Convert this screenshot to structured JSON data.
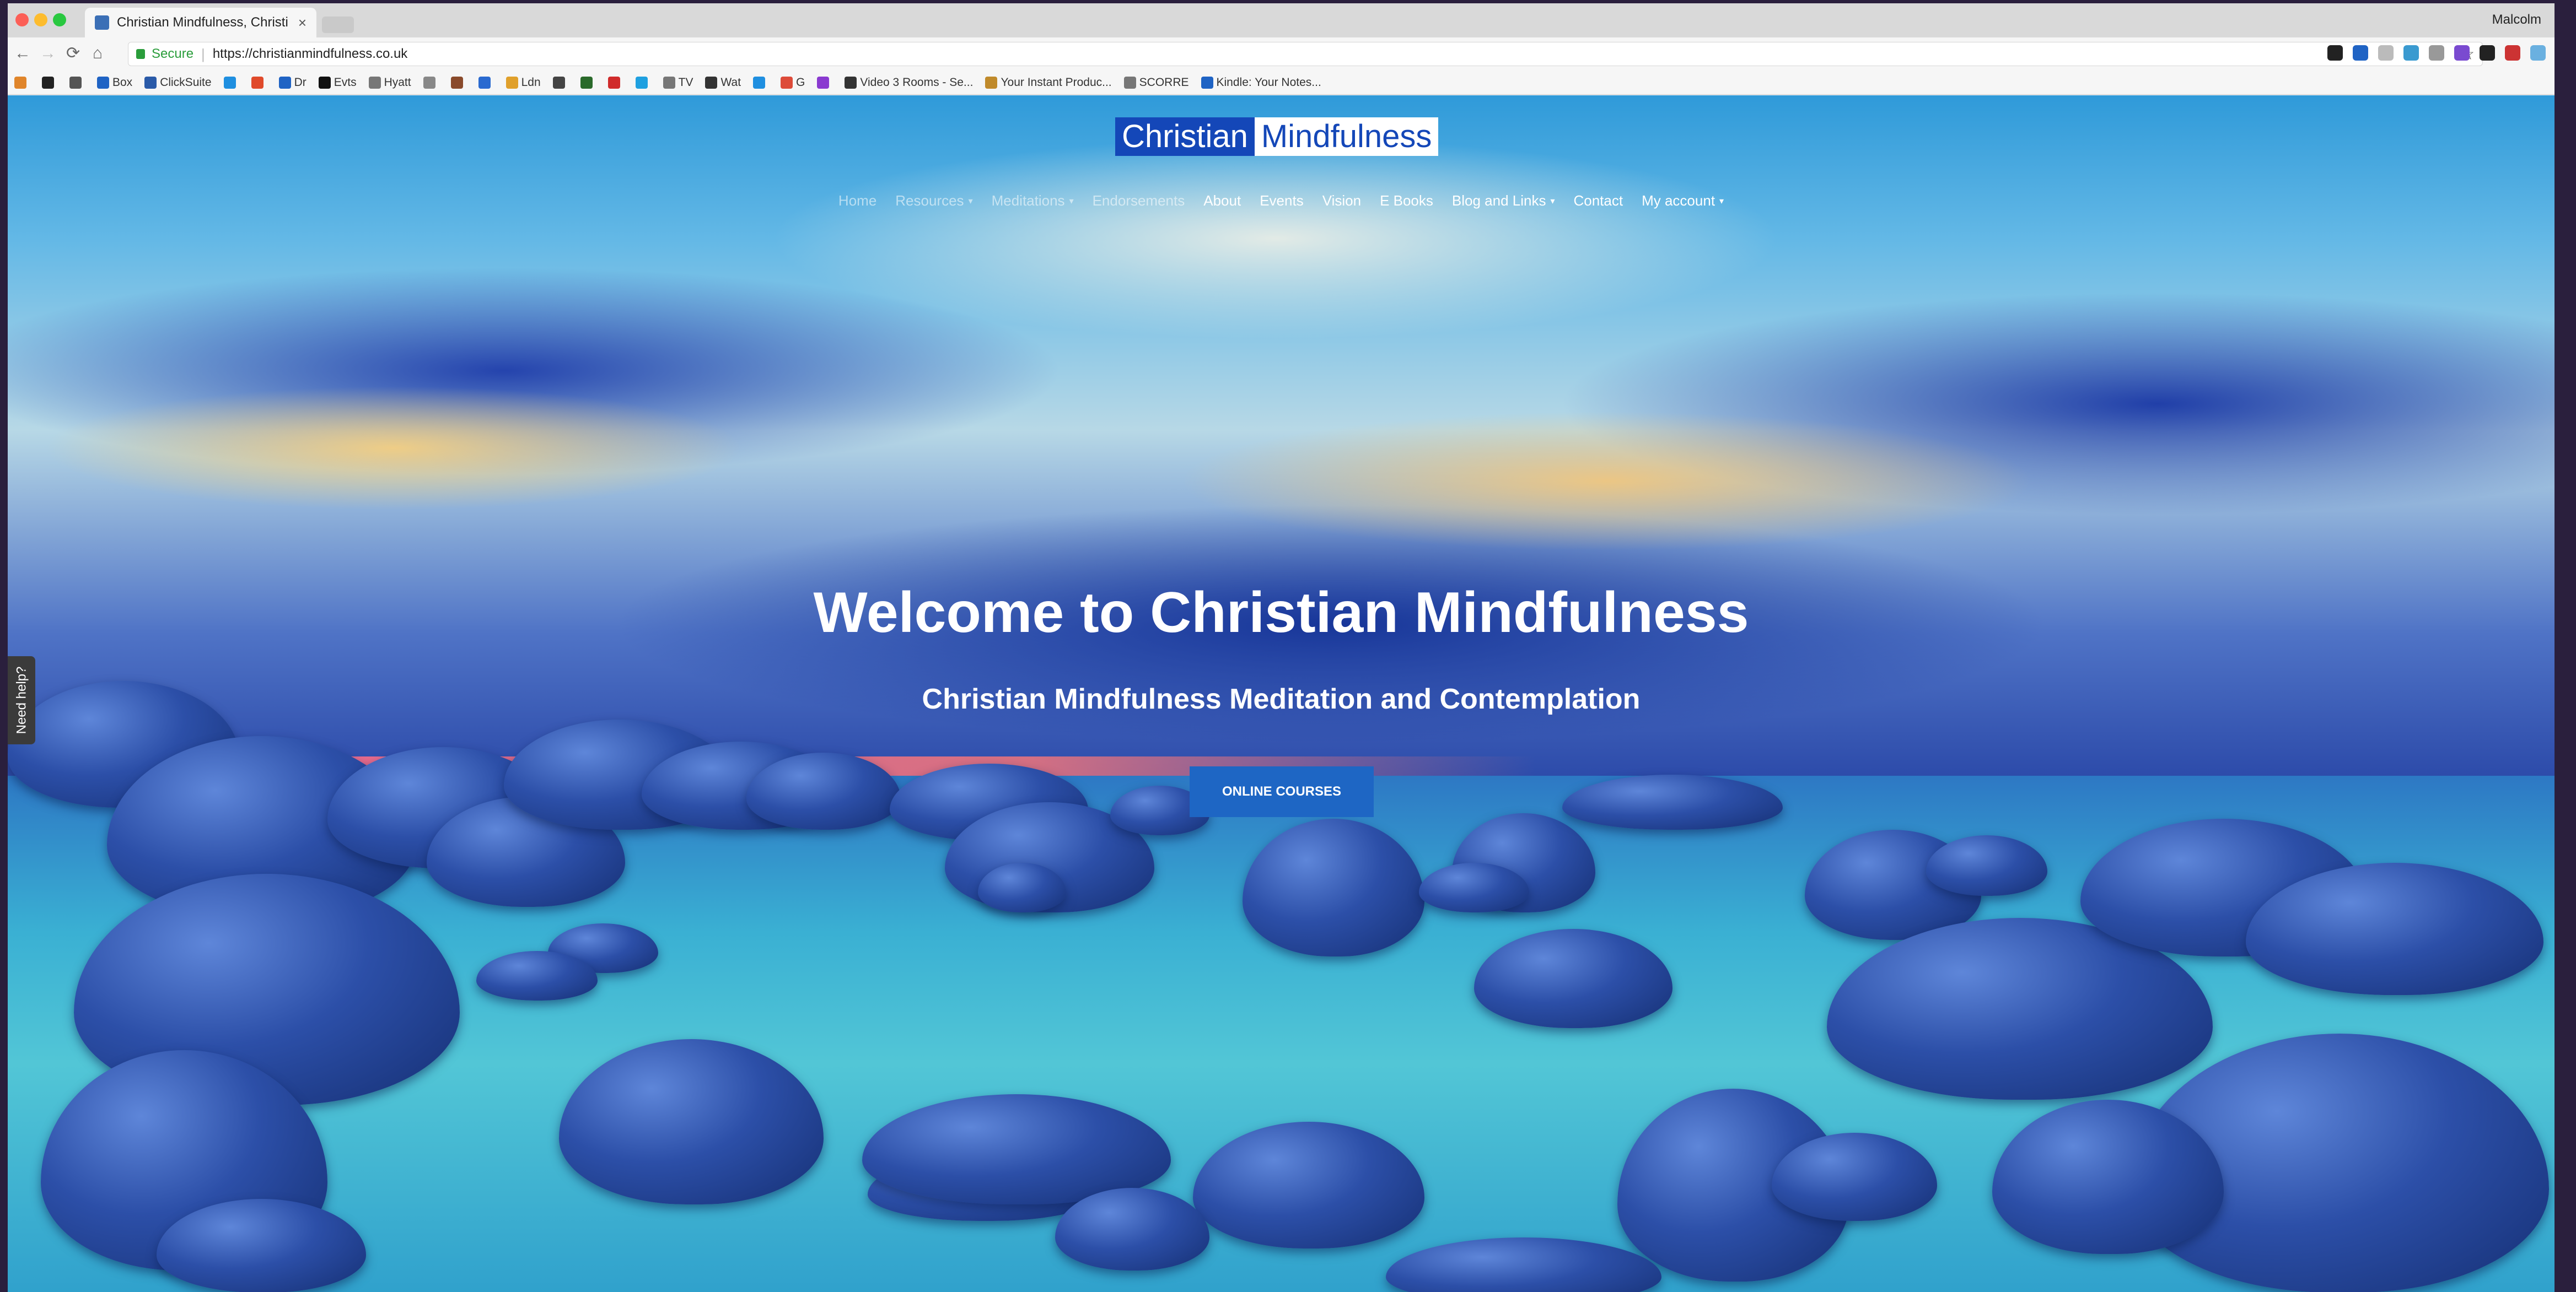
{
  "browser": {
    "tab_title": "Christian Mindfulness, Christi",
    "tab_close": "×",
    "profile_name": "Malcolm",
    "secure_label": "Secure",
    "url": "https://christianmindfulness.co.uk",
    "nav": {
      "back": "←",
      "forward": "→",
      "reload": "⟳",
      "home": "⌂",
      "star": "☆"
    },
    "bookmarks": [
      {
        "label": "",
        "color": "#e0852b"
      },
      {
        "label": "",
        "color": "#222222"
      },
      {
        "label": "",
        "color": "#555555"
      },
      {
        "label": "Box",
        "color": "#1f63c4"
      },
      {
        "label": "ClickSuite",
        "color": "#2a5aa8"
      },
      {
        "label": "",
        "color": "#1f8fe0"
      },
      {
        "label": "",
        "color": "#e04a2b"
      },
      {
        "label": "Dr",
        "color": "#1f63c4"
      },
      {
        "label": "Evts",
        "color": "#111111"
      },
      {
        "label": "Hyatt",
        "color": "#777777"
      },
      {
        "label": "",
        "color": "#888888"
      },
      {
        "label": "",
        "color": "#8a4a2b"
      },
      {
        "label": "",
        "color": "#2a6ad0"
      },
      {
        "label": "Ldn",
        "color": "#e0a02b"
      },
      {
        "label": "",
        "color": "#444444"
      },
      {
        "label": "",
        "color": "#2a6a2b"
      },
      {
        "label": "",
        "color": "#d02b2b"
      },
      {
        "label": "",
        "color": "#1fa0e0"
      },
      {
        "label": "TV",
        "color": "#777777"
      },
      {
        "label": "Wat",
        "color": "#333333"
      },
      {
        "label": "",
        "color": "#1f8fe0"
      },
      {
        "label": "G",
        "color": "#dd4b39"
      },
      {
        "label": "",
        "color": "#8a3ad0"
      },
      {
        "label": "Video 3 Rooms - Se...",
        "color": "#333333"
      },
      {
        "label": "Your Instant Produc...",
        "color": "#c08a2b"
      },
      {
        "label": "SCORRE",
        "color": "#777777"
      },
      {
        "label": "Kindle: Your Notes...",
        "color": "#1f63c4"
      }
    ],
    "extensions": [
      "#222222",
      "#1f63c4",
      "#bbbbbb",
      "#3a9ad0",
      "#999999",
      "#7a4ad0",
      "#222222",
      "#cc3333",
      "#6ab0e0"
    ]
  },
  "site": {
    "logo_part1": "Christian",
    "logo_part2": "Mindfulness",
    "nav": [
      {
        "label": "Home",
        "dim": true,
        "caret": ""
      },
      {
        "label": "Resources",
        "dim": true,
        "caret": "▾"
      },
      {
        "label": "Meditations",
        "dim": true,
        "caret": "▾"
      },
      {
        "label": "Endorsements",
        "dim": true,
        "caret": ""
      },
      {
        "label": "About",
        "dim": false,
        "caret": ""
      },
      {
        "label": "Events",
        "dim": false,
        "caret": ""
      },
      {
        "label": "Vision",
        "dim": false,
        "caret": ""
      },
      {
        "label": "E Books",
        "dim": false,
        "caret": ""
      },
      {
        "label": "Blog and Links",
        "dim": false,
        "caret": "▾"
      },
      {
        "label": "Contact",
        "dim": false,
        "caret": ""
      },
      {
        "label": "My account",
        "dim": false,
        "caret": "▾"
      }
    ],
    "hero_title": "Welcome to Christian Mindfulness",
    "hero_subtitle": "Christian Mindfulness Meditation and Contemplation",
    "cta_label": "ONLINE COURSES",
    "help_tab": "Need help?"
  }
}
